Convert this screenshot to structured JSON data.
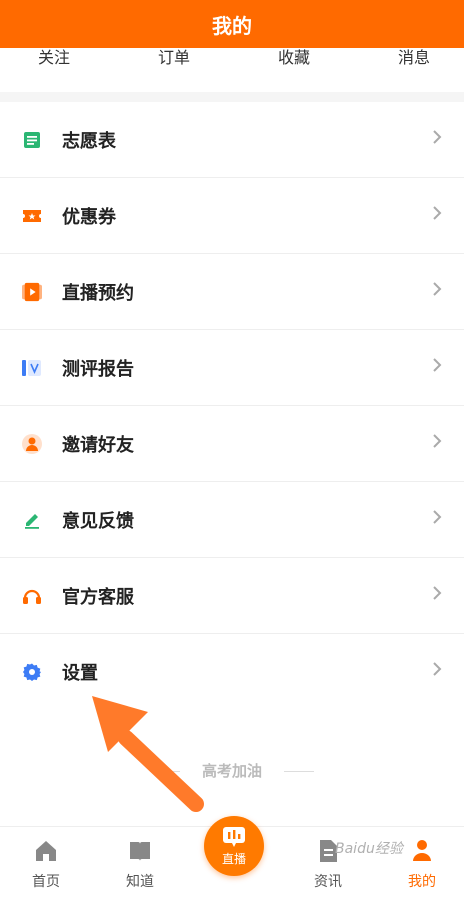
{
  "header": {
    "title": "我的"
  },
  "quick_links": [
    "关注",
    "订单",
    "收藏",
    "消息"
  ],
  "menu": [
    {
      "label": "志愿表",
      "icon": "form-icon",
      "color": "#2bb673"
    },
    {
      "label": "优惠券",
      "icon": "coupon-icon",
      "color": "#ff6a00"
    },
    {
      "label": "直播预约",
      "icon": "play-icon",
      "color": "#ff6a00"
    },
    {
      "label": "测评报告",
      "icon": "report-icon",
      "color": "#3d7cf5"
    },
    {
      "label": "邀请好友",
      "icon": "person-icon",
      "color": "#ff6a00"
    },
    {
      "label": "意见反馈",
      "icon": "edit-icon",
      "color": "#2bb673"
    },
    {
      "label": "官方客服",
      "icon": "headset-icon",
      "color": "#ff6a00"
    },
    {
      "label": "设置",
      "icon": "gear-icon",
      "color": "#3d7cf5"
    }
  ],
  "slogan": "高考加油",
  "tabs": {
    "home": "首页",
    "zhidao": "知道",
    "live": "直播",
    "news": "资讯",
    "mine": "我的"
  },
  "watermark": "Baidu经验",
  "colors": {
    "accent": "#ff6a00"
  }
}
